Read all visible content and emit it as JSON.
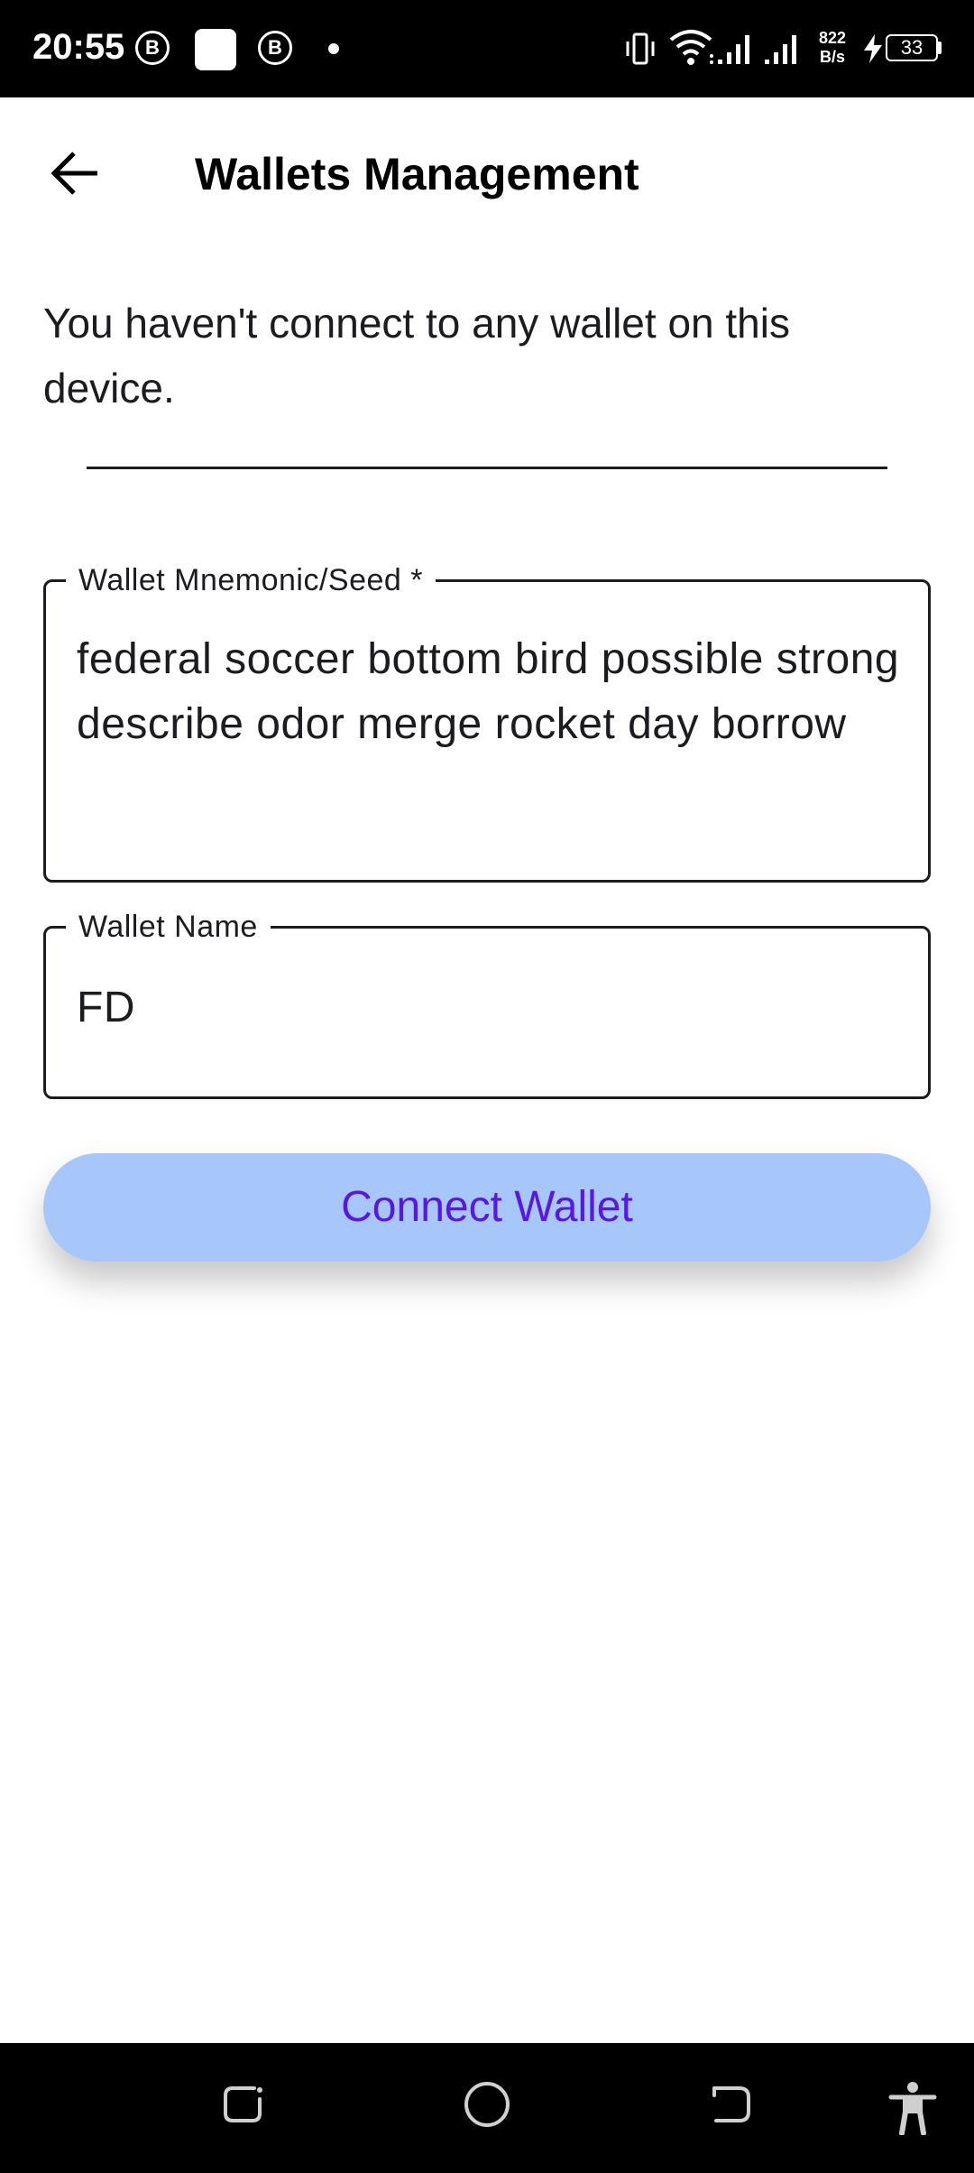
{
  "status_bar": {
    "time": "20:55",
    "b_icon_letter": "B",
    "net_speed_value": "822",
    "net_speed_unit": "B/s",
    "battery_level": "33"
  },
  "app_bar": {
    "back_icon": "arrow-left-icon",
    "title": "Wallets Management"
  },
  "main": {
    "info_text": "You haven't connect to any wallet on this device.",
    "mnemonic_field": {
      "label": "Wallet Mnemonic/Seed *",
      "value": "federal soccer bottom bird possible strong describe odor merge rocket day borrow"
    },
    "name_field": {
      "label": "Wallet Name",
      "value": "FD"
    },
    "connect_button_label": "Connect Wallet"
  },
  "nav_bar": {
    "icons": [
      "recents-icon",
      "home-icon",
      "back-icon",
      "accessibility-icon"
    ]
  },
  "colors": {
    "button_bg": "#a7c7fa",
    "button_text": "#5a16e6",
    "text": "#1c1b1f"
  }
}
